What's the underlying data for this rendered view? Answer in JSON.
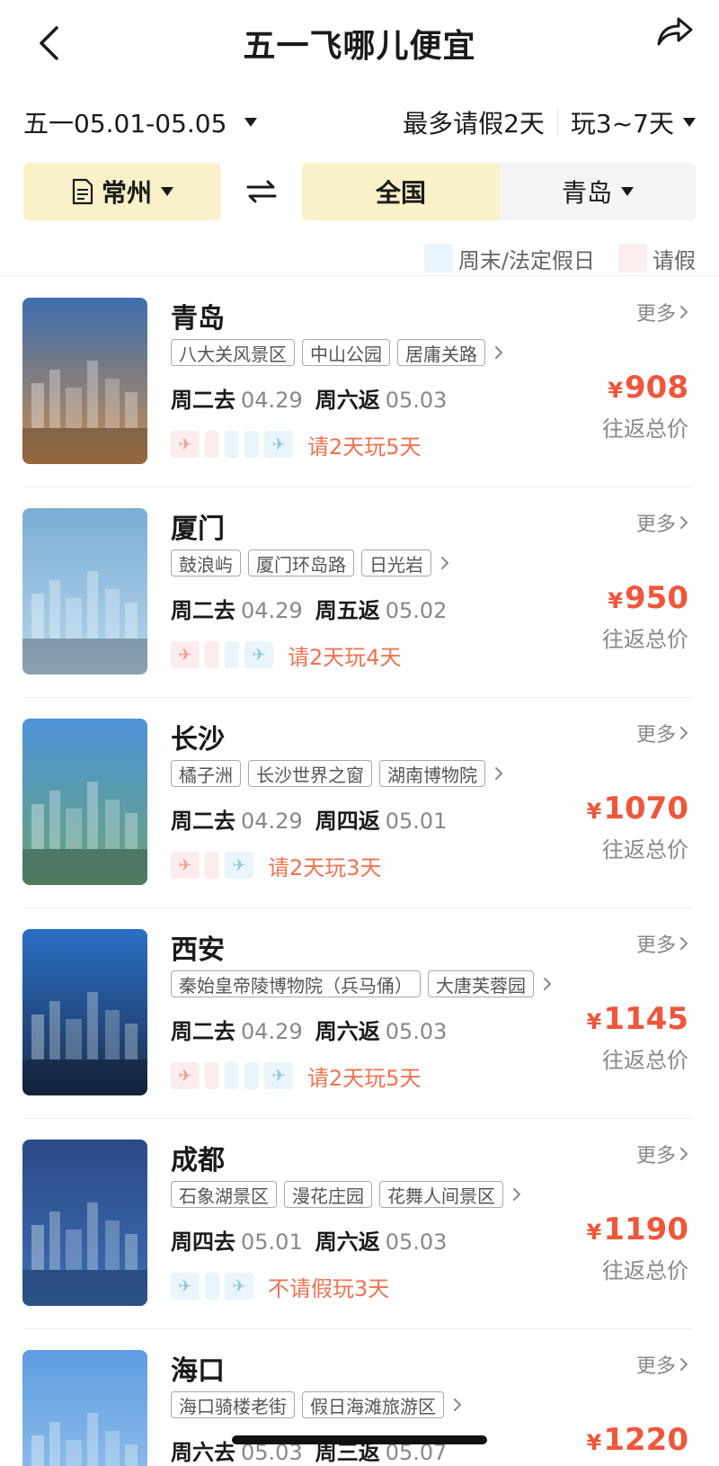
{
  "header": {
    "title": "五一飞哪儿便宜",
    "back_icon": "chevron-left-icon",
    "share_icon": "share-arrow-icon"
  },
  "filters": {
    "holiday": "五一05.01-05.05",
    "leave": "最多请假2天",
    "duration": "玩3~7天"
  },
  "cities": {
    "origin": "常州",
    "dest_all": "全国",
    "dest_city": "青岛"
  },
  "legend": {
    "weekend": "周末/法定假日",
    "leave": "请假"
  },
  "common": {
    "more": "更多",
    "price_label": "往返总价",
    "yen": "¥"
  },
  "results": [
    {
      "city": "青岛",
      "tags": [
        "八大关风景区",
        "中山公园",
        "居庸关路"
      ],
      "depart_day": "周二去",
      "depart_date": "04.29",
      "return_day": "周六返",
      "return_date": "05.03",
      "plan": "请2天玩5天",
      "calendar": [
        "plane-pink",
        "pink",
        "blue",
        "blue",
        "plane-blue"
      ],
      "price": "908",
      "colors": [
        "#3d6fb0",
        "#c98b4e"
      ]
    },
    {
      "city": "厦门",
      "tags": [
        "鼓浪屿",
        "厦门环岛路",
        "日光岩"
      ],
      "depart_day": "周二去",
      "depart_date": "04.29",
      "return_day": "周五返",
      "return_date": "05.02",
      "plan": "请2天玩4天",
      "calendar": [
        "plane-pink",
        "pink",
        "blue",
        "plane-blue"
      ],
      "price": "950",
      "colors": [
        "#7aaed6",
        "#b8d6ea"
      ]
    },
    {
      "city": "长沙",
      "tags": [
        "橘子洲",
        "长沙世界之窗",
        "湖南博物院"
      ],
      "depart_day": "周二去",
      "depart_date": "04.29",
      "return_day": "周四返",
      "return_date": "05.01",
      "plan": "请2天玩3天",
      "calendar": [
        "plane-pink",
        "pink",
        "plane-blue"
      ],
      "price": "1070",
      "colors": [
        "#4c93d8",
        "#6aa37a"
      ]
    },
    {
      "city": "西安",
      "tags": [
        "秦始皇帝陵博物院（兵马俑）",
        "大唐芙蓉园"
      ],
      "depart_day": "周二去",
      "depart_date": "04.29",
      "return_day": "周六返",
      "return_date": "05.03",
      "plan": "请2天玩5天",
      "calendar": [
        "plane-pink",
        "pink",
        "blue",
        "blue",
        "plane-blue"
      ],
      "price": "1145",
      "colors": [
        "#2a6fc4",
        "#1b2f4e"
      ]
    },
    {
      "city": "成都",
      "tags": [
        "石象湖景区",
        "漫花庄园",
        "花舞人间景区"
      ],
      "depart_day": "周四去",
      "depart_date": "05.01",
      "return_day": "周六返",
      "return_date": "05.03",
      "plan": "不请假玩3天",
      "calendar": [
        "plane-blue",
        "blue",
        "plane-blue"
      ],
      "price": "1190",
      "colors": [
        "#2c4a86",
        "#3a6fb4"
      ]
    },
    {
      "city": "海口",
      "tags": [
        "海口骑楼老街",
        "假日海滩旅游区"
      ],
      "depart_day": "周六去",
      "depart_date": "05.03",
      "return_day": "周三返",
      "return_date": "05.07",
      "plan": "",
      "calendar": [],
      "price": "1220",
      "colors": [
        "#5f9ce0",
        "#9bc7ec"
      ]
    }
  ]
}
